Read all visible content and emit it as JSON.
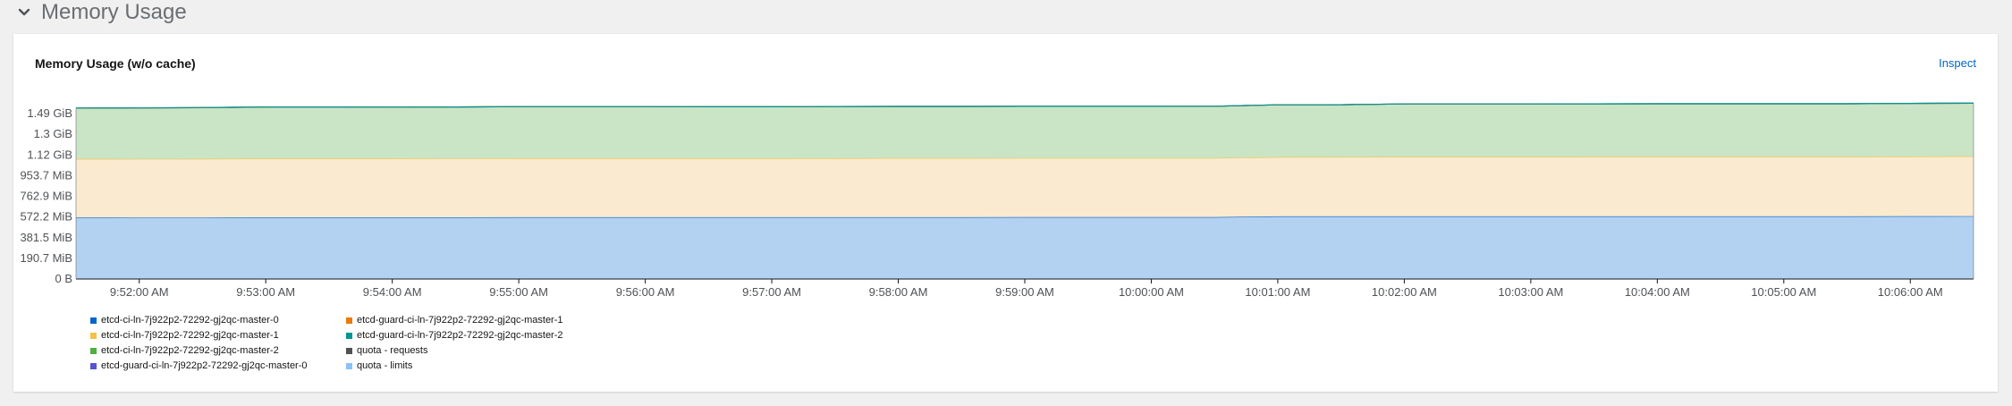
{
  "section": {
    "title": "Memory Usage",
    "chevron_icon": "chevron-down-icon"
  },
  "card": {
    "title": "Memory Usage (w/o cache)",
    "inspect_label": "Inspect"
  },
  "chart_data": {
    "type": "area",
    "stacked": true,
    "title": "Memory Usage (w/o cache)",
    "xlabel": "",
    "ylabel": "",
    "x": [
      "9:51:30 AM",
      "9:52:00 AM",
      "9:52:30 AM",
      "9:53:00 AM",
      "9:53:30 AM",
      "9:54:00 AM",
      "9:54:30 AM",
      "9:55:00 AM",
      "9:55:30 AM",
      "9:56:00 AM",
      "9:56:30 AM",
      "9:57:00 AM",
      "9:57:30 AM",
      "9:58:00 AM",
      "9:58:30 AM",
      "9:59:00 AM",
      "9:59:30 AM",
      "10:00:00 AM",
      "10:00:30 AM",
      "10:01:00 AM",
      "10:01:30 AM",
      "10:02:00 AM",
      "10:02:30 AM",
      "10:03:00 AM",
      "10:03:30 AM",
      "10:04:00 AM",
      "10:04:30 AM",
      "10:05:00 AM",
      "10:05:30 AM",
      "10:06:00 AM",
      "10:06:30 AM"
    ],
    "x_ticks": [
      "9:52:00 AM",
      "9:53:00 AM",
      "9:54:00 AM",
      "9:55:00 AM",
      "9:56:00 AM",
      "9:57:00 AM",
      "9:58:00 AM",
      "9:59:00 AM",
      "10:00:00 AM",
      "10:01:00 AM",
      "10:02:00 AM",
      "10:03:00 AM",
      "10:04:00 AM",
      "10:05:00 AM",
      "10:06:00 AM"
    ],
    "y_ticks": [
      {
        "label": "0 B",
        "value": 0
      },
      {
        "label": "190.7 MiB",
        "value": 190.7
      },
      {
        "label": "381.5 MiB",
        "value": 381.5
      },
      {
        "label": "572.2 MiB",
        "value": 572.2
      },
      {
        "label": "762.9 MiB",
        "value": 762.9
      },
      {
        "label": "953.7 MiB",
        "value": 953.7
      },
      {
        "label": "1.12 GiB",
        "value": 1144.4
      },
      {
        "label": "1.3 GiB",
        "value": 1335.1
      },
      {
        "label": "1.49 GiB",
        "value": 1525.9
      }
    ],
    "y_unit": "MiB",
    "ylim": [
      0,
      1650
    ],
    "grid": true,
    "legend_position": "bottom-left",
    "series": [
      {
        "name": "etcd-ci-ln-7j922p2-72292-gj2qc-master-0",
        "color": "#0066cc",
        "fill": "#b3d1f0",
        "values": [
          567,
          568,
          568,
          569,
          569,
          569,
          569,
          570,
          570,
          570,
          570,
          570,
          570,
          570,
          570,
          571,
          571,
          571,
          571,
          578,
          578,
          578,
          578,
          578,
          578,
          578,
          578,
          578,
          578,
          579,
          580
        ]
      },
      {
        "name": "etcd-ci-ln-7j922p2-72292-gj2qc-master-1",
        "color": "#f4c145",
        "fill": "#faead0",
        "values": [
          540,
          540,
          541,
          542,
          542,
          542,
          543,
          544,
          544,
          544,
          543,
          543,
          544,
          545,
          545,
          545,
          545,
          545,
          545,
          547,
          548,
          549,
          549,
          549,
          550,
          550,
          550,
          550,
          550,
          551,
          552
        ]
      },
      {
        "name": "etcd-ci-ln-7j922p2-72292-gj2qc-master-2",
        "color": "#4cb140",
        "fill": "#c9e5c5",
        "values": [
          470,
          470,
          472,
          476,
          476,
          475,
          475,
          476,
          476,
          476,
          476,
          476,
          477,
          477,
          477,
          477,
          477,
          477,
          478,
          482,
          482,
          488,
          488,
          488,
          488,
          489,
          489,
          489,
          489,
          490,
          490
        ]
      },
      {
        "name": "etcd-guard-ci-ln-7j922p2-72292-gj2qc-master-0",
        "color": "#5752d1",
        "fill": "#5752d1",
        "values": [
          0.1,
          0.1,
          0.1,
          0.1,
          0.1,
          0.1,
          0.1,
          0.1,
          0.1,
          0.1,
          0.1,
          0.1,
          0.1,
          0.1,
          0.1,
          0.1,
          0.1,
          0.1,
          0.1,
          0.1,
          0.1,
          0.1,
          0.1,
          0.1,
          0.1,
          0.1,
          0.1,
          0.1,
          0.1,
          0.1,
          0.1
        ]
      },
      {
        "name": "etcd-guard-ci-ln-7j922p2-72292-gj2qc-master-1",
        "color": "#ec7a08",
        "fill": "#ec7a08",
        "values": [
          0.1,
          0.1,
          0.1,
          0.1,
          0.1,
          0.1,
          0.1,
          0.1,
          0.1,
          0.1,
          0.1,
          0.1,
          0.1,
          0.1,
          0.1,
          0.1,
          0.1,
          0.1,
          0.1,
          0.1,
          0.1,
          0.1,
          0.1,
          0.1,
          0.1,
          0.1,
          0.1,
          0.1,
          0.1,
          0.1,
          0.1
        ]
      },
      {
        "name": "etcd-guard-ci-ln-7j922p2-72292-gj2qc-master-2",
        "color": "#009596",
        "fill": "#009596",
        "values": [
          0.1,
          0.1,
          0.1,
          0.1,
          0.1,
          0.1,
          0.1,
          0.1,
          0.1,
          0.1,
          0.1,
          0.1,
          0.1,
          0.1,
          0.1,
          0.1,
          0.1,
          0.1,
          0.1,
          0.1,
          0.1,
          0.1,
          0.1,
          0.1,
          0.1,
          0.1,
          0.1,
          0.1,
          0.1,
          0.1,
          0.1
        ]
      }
    ],
    "legend": [
      {
        "name": "etcd-ci-ln-7j922p2-72292-gj2qc-master-0",
        "color": "#0066cc"
      },
      {
        "name": "etcd-ci-ln-7j922p2-72292-gj2qc-master-1",
        "color": "#f4c145"
      },
      {
        "name": "etcd-ci-ln-7j922p2-72292-gj2qc-master-2",
        "color": "#4cb140"
      },
      {
        "name": "etcd-guard-ci-ln-7j922p2-72292-gj2qc-master-0",
        "color": "#5752d1"
      },
      {
        "name": "etcd-guard-ci-ln-7j922p2-72292-gj2qc-master-1",
        "color": "#ec7a08"
      },
      {
        "name": "etcd-guard-ci-ln-7j922p2-72292-gj2qc-master-2",
        "color": "#009596"
      },
      {
        "name": "quota - requests",
        "color": "#4f5255"
      },
      {
        "name": "quota - limits",
        "color": "#8bc1f7"
      }
    ]
  }
}
